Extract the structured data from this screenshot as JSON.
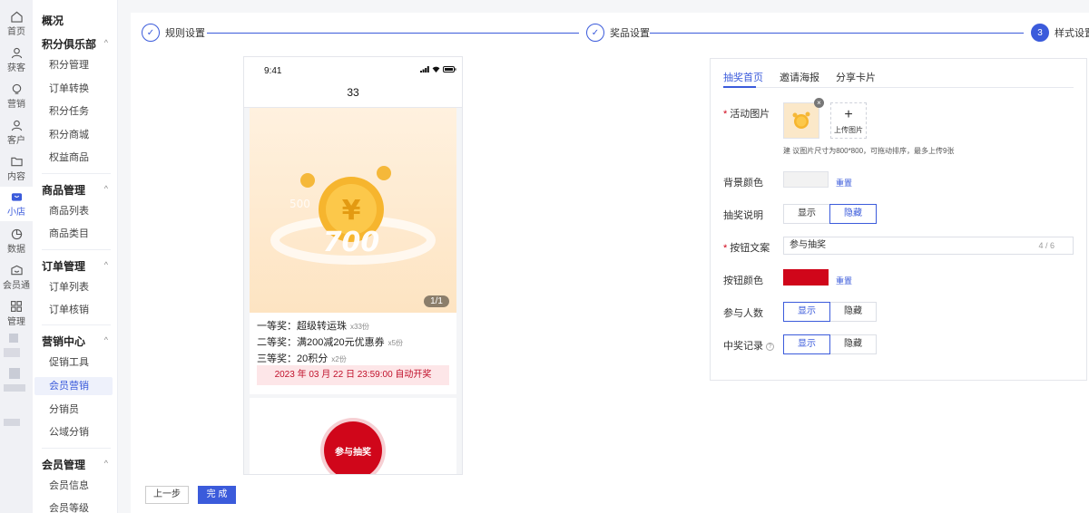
{
  "rail": {
    "items": [
      {
        "label": "首页",
        "icon": "home-icon"
      },
      {
        "label": "获客",
        "icon": "user-plus-icon"
      },
      {
        "label": "营销",
        "icon": "bulb-icon"
      },
      {
        "label": "客户",
        "icon": "user-icon"
      },
      {
        "label": "内容",
        "icon": "folder-icon"
      },
      {
        "label": "小店",
        "icon": "shop-icon"
      },
      {
        "label": "数据",
        "icon": "pie-chart-icon"
      },
      {
        "label": "会员通",
        "icon": "member-icon"
      },
      {
        "label": "管理",
        "icon": "grid-icon"
      }
    ],
    "active_index": 5
  },
  "subnav": {
    "overview": "概况",
    "groups": [
      {
        "title": "积分俱乐部",
        "items": [
          "积分管理",
          "订单转换",
          "积分任务",
          "积分商城",
          "权益商品"
        ]
      },
      {
        "title": "商品管理",
        "items": [
          "商品列表",
          "商品类目"
        ]
      },
      {
        "title": "订单管理",
        "items": [
          "订单列表",
          "订单核销"
        ]
      },
      {
        "title": "营销中心",
        "items": [
          "促销工具",
          "会员营销",
          "分销员",
          "公域分销"
        ]
      },
      {
        "title": "会员管理",
        "items": [
          "会员信息",
          "会员等级"
        ]
      }
    ],
    "active_item": "会员营销"
  },
  "steps": [
    {
      "label": "规则设置",
      "status": "done"
    },
    {
      "label": "奖品设置",
      "status": "done"
    },
    {
      "label": "样式设置",
      "status": "current",
      "number": "3"
    }
  ],
  "preview": {
    "time": "9:41",
    "title": "33",
    "pager": "1/1",
    "prizes": [
      {
        "text": "一等奖：超级转运珠",
        "count": "x33份"
      },
      {
        "text": "二等奖：满200减20元优惠券",
        "count": "x5份"
      },
      {
        "text": "三等奖：20积分",
        "count": "x2份"
      }
    ],
    "draw_time": "2023 年 03 月 22 日 23:59:00 自动开奖",
    "join_button": "参与抽奖",
    "banner_text": "700"
  },
  "panel": {
    "tabs": [
      "抽奖首页",
      "邀请海报",
      "分享卡片"
    ],
    "active_tab": 0,
    "activity_image": {
      "label": "活动图片",
      "upload_label": "上传图片",
      "hint": "建 议图片尺寸为800*800，可拖动排序，最多上传9张"
    },
    "bg_color": {
      "label": "背景颜色",
      "reset": "重置",
      "value": "#f2f2f2"
    },
    "description": {
      "label": "抽奖说明",
      "options": [
        "显示",
        "隐藏"
      ],
      "selected": 1
    },
    "button_text": {
      "label": "按钮文案",
      "value": "参与抽奖",
      "count": "4 / 6"
    },
    "button_color": {
      "label": "按钮颜色",
      "reset": "重置",
      "value": "#d0061a"
    },
    "participants": {
      "label": "参与人数",
      "options": [
        "显示",
        "隐藏"
      ],
      "selected": 0
    },
    "records": {
      "label": "中奖记录",
      "options": [
        "显示",
        "隐藏"
      ],
      "selected": 0
    }
  },
  "footer": {
    "prev": "上一步",
    "done": "完 成"
  },
  "colors": {
    "accent": "#3b5bdb",
    "red": "#d0061a"
  }
}
